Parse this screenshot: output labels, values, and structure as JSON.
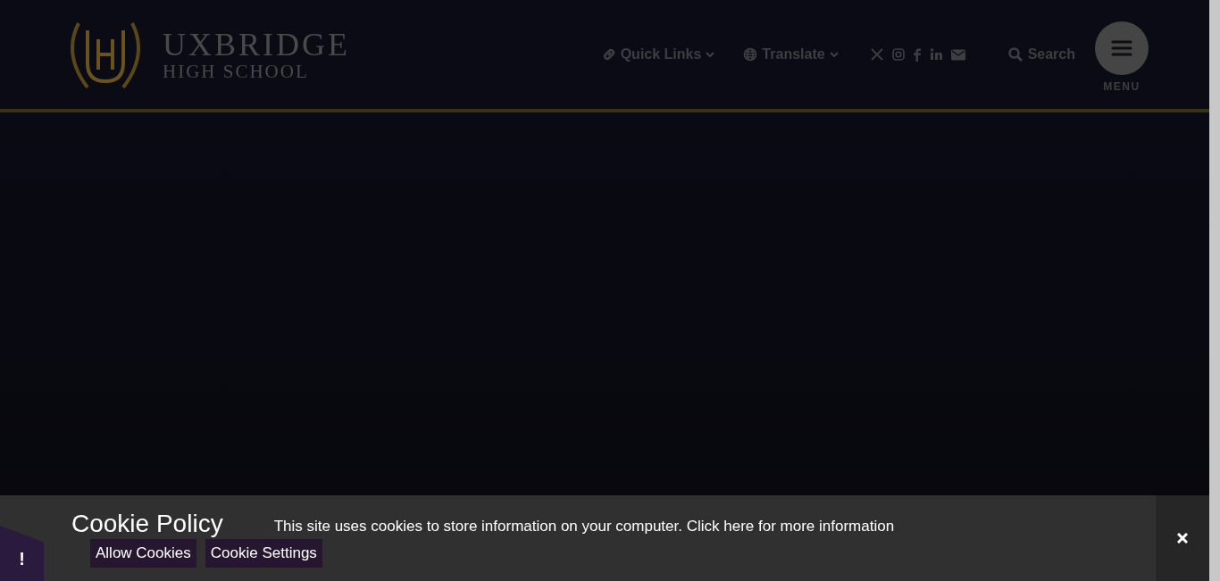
{
  "header": {
    "logo": {
      "line_1": "UXBRIDGE",
      "line_2": "HIGH SCHOOL"
    },
    "nav": [
      {
        "kind": "dropdown",
        "label": "Quick Links"
      },
      {
        "kind": "dropdown",
        "label": "Translate"
      }
    ],
    "search": {
      "label": "Search"
    },
    "menu": {
      "label": "MENU"
    }
  },
  "cookie_bar": {
    "title": "Cookie Policy",
    "message": "This site uses cookies to store information on your computer. Click here for more information",
    "buttons": [
      "Allow Cookies",
      "Cookie Settings"
    ],
    "notice_badge": "!"
  }
}
